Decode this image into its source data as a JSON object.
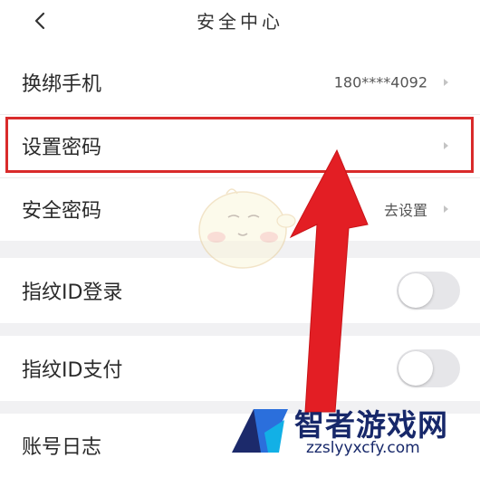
{
  "header": {
    "title": "安全中心",
    "back_icon": "chevron-left-icon"
  },
  "rows": {
    "phone": {
      "label": "换绑手机",
      "value": "180****4092"
    },
    "password": {
      "label": "设置密码"
    },
    "security_code": {
      "label": "安全密码",
      "value": "去设置"
    },
    "fingerprint_login": {
      "label": "指纹ID登录",
      "enabled": false
    },
    "fingerprint_pay": {
      "label": "指纹ID支付",
      "enabled": false
    },
    "account_log": {
      "label": "账号日志"
    }
  },
  "annotation": {
    "highlight_color": "#d92b2b",
    "arrow_color": "#e31e24"
  },
  "watermark": {
    "text": "智者游戏网",
    "url": "zzslyyxcfy.com"
  }
}
